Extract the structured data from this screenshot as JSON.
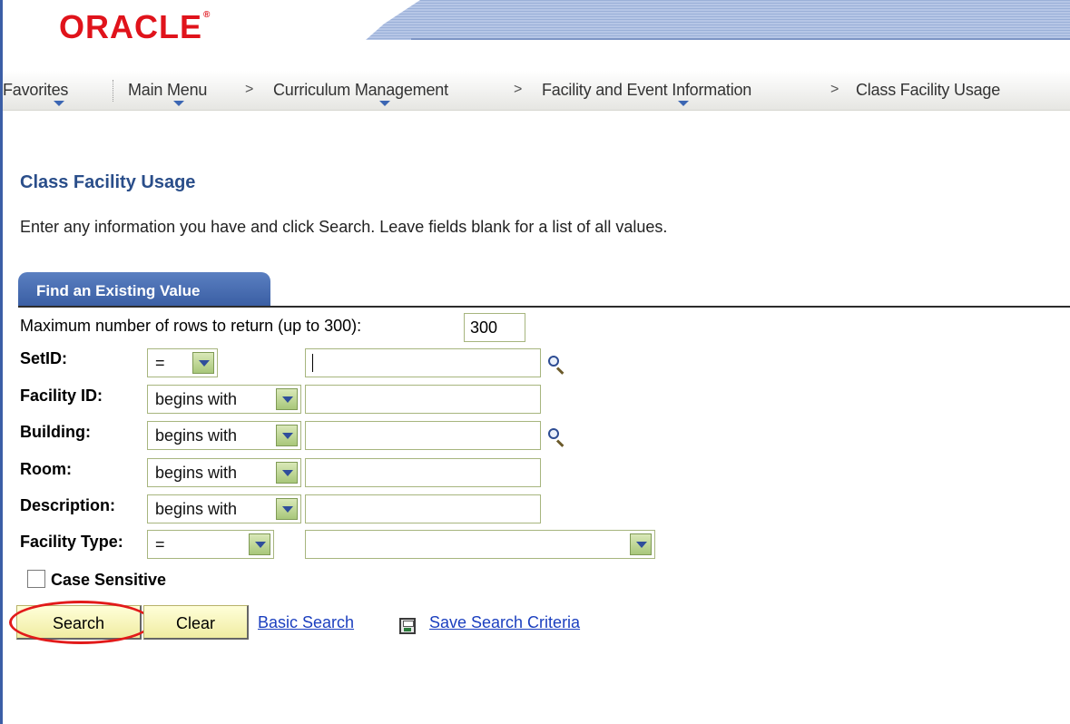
{
  "header": {
    "logo_text": "ORACLE",
    "logo_mark": "®"
  },
  "nav": {
    "items": [
      {
        "label": "Favorites",
        "has_menu": true
      },
      {
        "label": "Main Menu",
        "has_menu": true
      },
      {
        "label": "Curriculum Management",
        "has_menu": true
      },
      {
        "label": "Facility and Event Information",
        "has_menu": true
      },
      {
        "label": "Class Facility Usage",
        "has_menu": false
      }
    ],
    "separator": ">"
  },
  "page": {
    "title": "Class Facility Usage",
    "instructions": "Enter any information you have and click Search. Leave fields blank for a list of all values."
  },
  "tab": {
    "label": "Find an Existing Value"
  },
  "form": {
    "max_rows_label": "Maximum number of rows to return (up to 300):",
    "max_rows_value": "300",
    "fields": [
      {
        "label": "SetID:",
        "operator": "=",
        "value": "",
        "has_lookup": true
      },
      {
        "label": "Facility ID:",
        "operator": "begins with",
        "value": "",
        "has_lookup": false
      },
      {
        "label": "Building:",
        "operator": "begins with",
        "value": "",
        "has_lookup": true
      },
      {
        "label": "Room:",
        "operator": "begins with",
        "value": "",
        "has_lookup": false
      },
      {
        "label": "Description:",
        "operator": "begins with",
        "value": "",
        "has_lookup": false
      },
      {
        "label": "Facility Type:",
        "operator": "=",
        "value": "",
        "has_lookup": false
      }
    ],
    "case_sensitive_label": "Case Sensitive",
    "case_sensitive_checked": false
  },
  "actions": {
    "search_label": "Search",
    "clear_label": "Clear",
    "basic_search_label": "Basic Search",
    "save_criteria_label": "Save Search Criteria"
  },
  "colors": {
    "logo_red": "#e0131b",
    "title_blue": "#2a4e8a",
    "tab_blue": "#3a5ea3",
    "link_blue": "#1b3fbf",
    "button_yellow": "#f0eca2",
    "highlight_red": "#e21a1a"
  },
  "icons": {
    "lookup": "magnifier-icon",
    "save": "floppy-disk-icon",
    "dropdown": "chevron-down-icon"
  }
}
